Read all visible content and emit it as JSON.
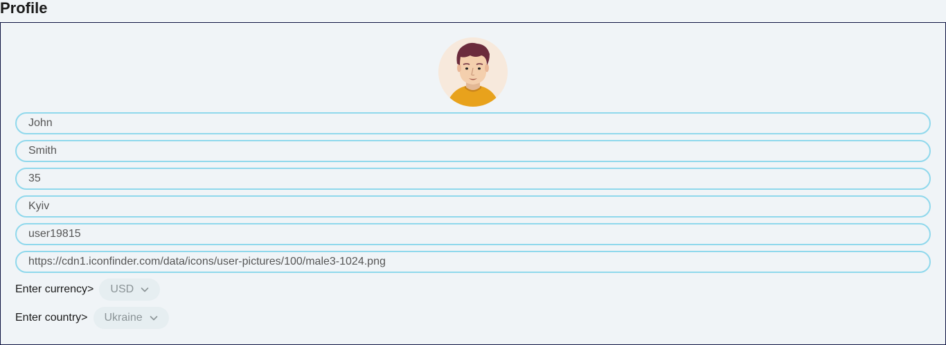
{
  "page": {
    "title": "Profile"
  },
  "avatar": {
    "icon": "male-user-avatar"
  },
  "fields": [
    {
      "name": "first-name-field",
      "value": "John"
    },
    {
      "name": "last-name-field",
      "value": "Smith"
    },
    {
      "name": "age-field",
      "value": "35"
    },
    {
      "name": "city-field",
      "value": "Kyiv"
    },
    {
      "name": "username-field",
      "value": "user19815"
    },
    {
      "name": "avatar-url-field",
      "value": "https://cdn1.iconfinder.com/data/icons/user-pictures/100/male3-1024.png"
    }
  ],
  "currency": {
    "label": "Enter currency>",
    "selected": "USD"
  },
  "country": {
    "label": "Enter country>",
    "selected": "Ukraine"
  },
  "colors": {
    "field_border": "#8fd8ec",
    "card_border": "#0d1240",
    "background": "#f0f4f7",
    "select_bg": "#e6eef1"
  }
}
